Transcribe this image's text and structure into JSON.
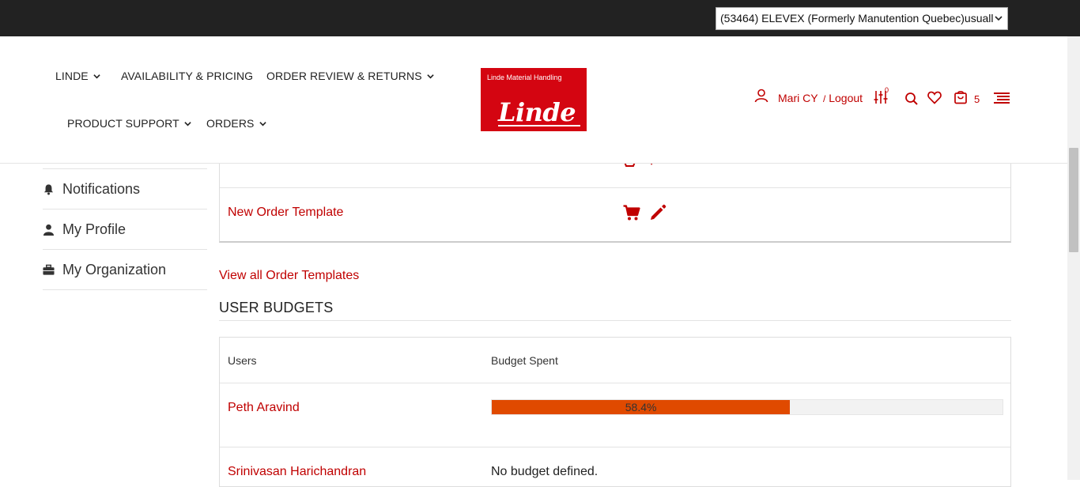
{
  "account_select": {
    "value": "(53464) ELEVEX (Formerly Manutention Quebec)usuall"
  },
  "nav": {
    "linde": "LINDE",
    "availability": "AVAILABILITY & PRICING",
    "order_review": "ORDER REVIEW & RETURNS",
    "product_support": "PRODUCT SUPPORT",
    "orders": "ORDERS"
  },
  "logo": {
    "tagline": "Linde Material Handling",
    "wordmark": "Linde"
  },
  "user": {
    "name": "Mari CY",
    "slash": "/",
    "logout": "Logout"
  },
  "compare_count": "0",
  "cart_count": "5",
  "sidebar": {
    "items": [
      {
        "label": "Notifications",
        "icon": "bell-icon"
      },
      {
        "label": "My Profile",
        "icon": "user-icon"
      },
      {
        "label": "My Organization",
        "icon": "briefcase-icon"
      }
    ]
  },
  "templates": {
    "rows": [
      {
        "name": "New Order Template"
      }
    ],
    "view_all": "View all Order Templates"
  },
  "budgets": {
    "title": "USER BUDGETS",
    "col_users": "Users",
    "col_spent": "Budget Spent",
    "rows": [
      {
        "user": "Peth Aravind",
        "percent": 58.4,
        "label": "58.4%"
      },
      {
        "user": "Srinivasan Harichandran",
        "status": "No budget defined."
      }
    ]
  },
  "colors": {
    "brand": "#c00000",
    "logo_red": "#d40511",
    "progress": "#e04a00",
    "topbar": "#222222"
  }
}
